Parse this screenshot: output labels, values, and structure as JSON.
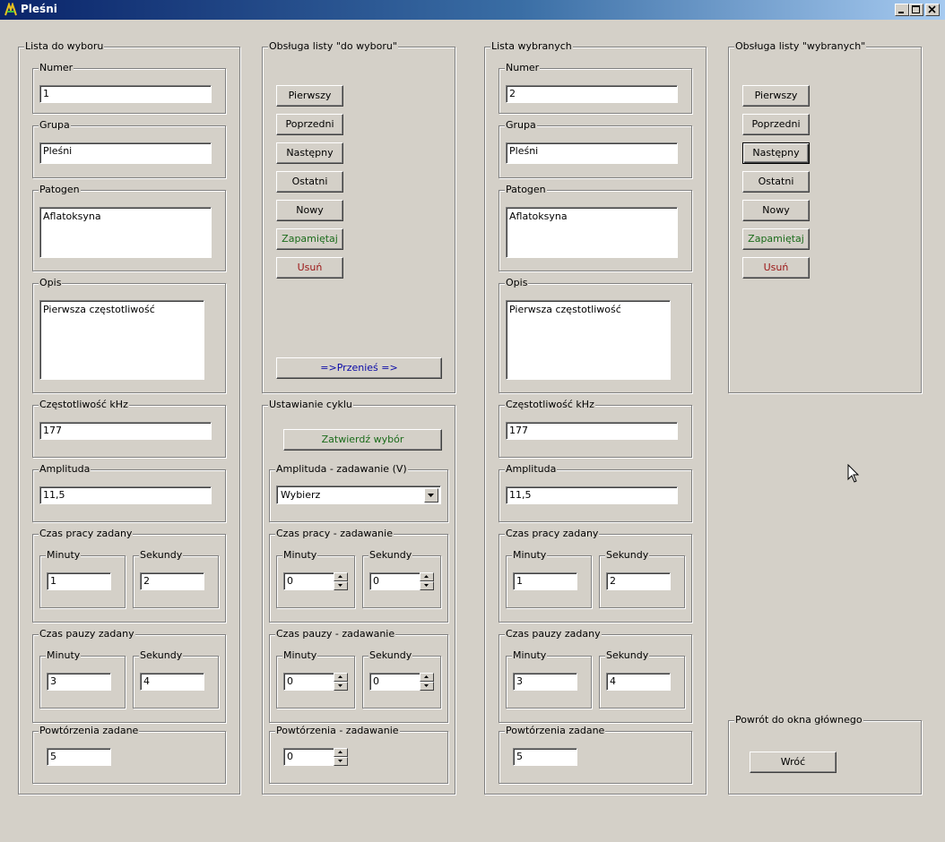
{
  "window": {
    "title": "Pleśni"
  },
  "left_list": {
    "legend": "Lista do wyboru",
    "numer": {
      "label": "Numer",
      "value": "1"
    },
    "grupa": {
      "label": "Grupa",
      "value": "Pleśni"
    },
    "patogen": {
      "label": "Patogen",
      "value": "Aflatoksyna"
    },
    "opis": {
      "label": "Opis",
      "value": "Pierwsza częstotliwość"
    },
    "czest": {
      "label": "Częstotliwość kHz",
      "value": "177"
    },
    "amplituda": {
      "label": "Amplituda",
      "value": "11,5"
    },
    "czas_pracy": {
      "label": "Czas pracy zadany",
      "min_label": "Minuty",
      "min_value": "1",
      "sek_label": "Sekundy",
      "sek_value": "2"
    },
    "czas_pauzy": {
      "label": "Czas pauzy zadany",
      "min_label": "Minuty",
      "min_value": "3",
      "sek_label": "Sekundy",
      "sek_value": "4"
    },
    "powt": {
      "label": "Powtórzenia zadane",
      "value": "5"
    }
  },
  "left_nav": {
    "legend": "Obsługa listy \"do wyboru\"",
    "buttons": [
      "Pierwszy",
      "Poprzedni",
      "Następny",
      "Ostatni",
      "Nowy",
      "Zapamiętaj",
      "Usuń"
    ],
    "move_label": "=>Przenieś =>"
  },
  "cycle": {
    "legend": "Ustawianie cyklu",
    "confirm_label": "Zatwierdź wybór",
    "amp_legend": "Amplituda - zadawanie (V)",
    "amp_selected": "Wybierz",
    "praca_legend": "Czas pracy - zadawanie",
    "pauza_legend": "Czas pauzy - zadawanie",
    "min_label": "Minuty",
    "sek_label": "Sekundy",
    "praca_min": "0",
    "praca_sek": "0",
    "pauza_min": "0",
    "pauza_sek": "0",
    "powt_legend": "Powtórzenia - zadawanie",
    "powt_value": "0"
  },
  "right_list": {
    "legend": "Lista wybranych",
    "numer": {
      "label": "Numer",
      "value": "2"
    },
    "grupa": {
      "label": "Grupa",
      "value": "Pleśni"
    },
    "patogen": {
      "label": "Patogen",
      "value": "Aflatoksyna"
    },
    "opis": {
      "label": "Opis",
      "value": "Pierwsza częstotliwość"
    },
    "czest": {
      "label": "Częstotliwość kHz",
      "value": "177"
    },
    "amplituda": {
      "label": "Amplituda",
      "value": "11,5"
    },
    "czas_pracy": {
      "label": "Czas pracy zadany",
      "min_label": "Minuty",
      "min_value": "1",
      "sek_label": "Sekundy",
      "sek_value": "2"
    },
    "czas_pauzy": {
      "label": "Czas pauzy zadany",
      "min_label": "Minuty",
      "min_value": "3",
      "sek_label": "Sekundy",
      "sek_value": "4"
    },
    "powt": {
      "label": "Powtórzenia zadane",
      "value": "5"
    }
  },
  "right_nav": {
    "legend": "Obsługa listy \"wybranych\"",
    "buttons": [
      "Pierwszy",
      "Poprzedni",
      "Następny",
      "Ostatni",
      "Nowy",
      "Zapamiętaj",
      "Usuń"
    ]
  },
  "back": {
    "legend": "Powrót do okna głównego",
    "button_label": "Wróć"
  },
  "colors": {
    "title_start": "#0a246a",
    "title_end": "#a6caf0",
    "face": "#d4d0c8",
    "save_text": "#1a6b1a",
    "delete_text": "#9b1414",
    "move_text": "#0a0aa8"
  }
}
